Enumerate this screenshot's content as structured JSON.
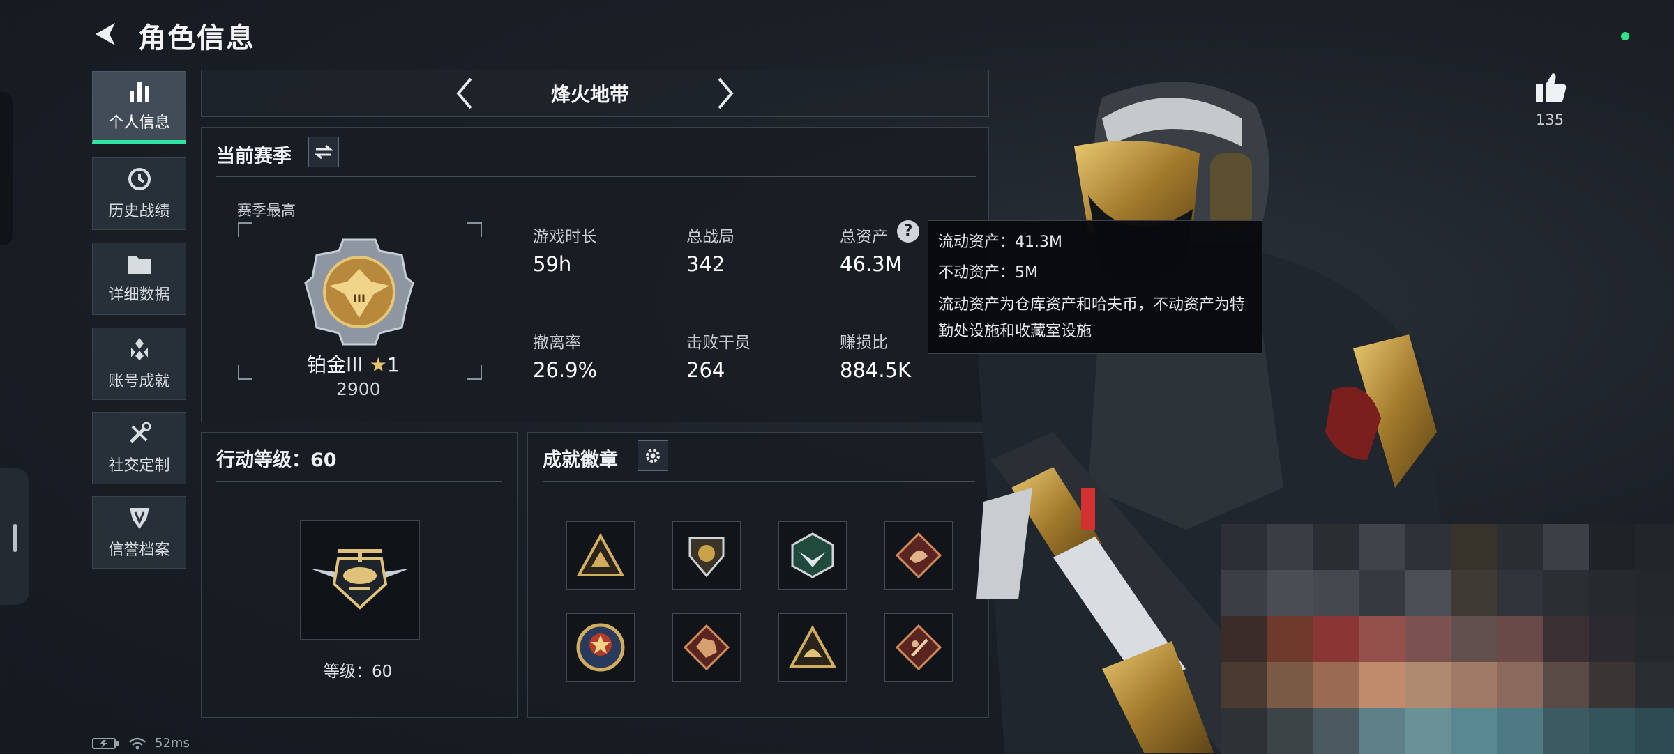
{
  "header": {
    "title": "角色信息"
  },
  "sidebar": {
    "items": [
      {
        "label": "个人信息",
        "icon": "bar-chart-icon",
        "active": true
      },
      {
        "label": "历史战绩",
        "icon": "clock-history-icon",
        "active": false
      },
      {
        "label": "详细数据",
        "icon": "folder-icon",
        "active": false
      },
      {
        "label": "账号成就",
        "icon": "achievement-icon",
        "active": false
      },
      {
        "label": "社交定制",
        "icon": "tools-icon",
        "active": false
      },
      {
        "label": "信誉档案",
        "icon": "shield-badge-icon",
        "active": false
      }
    ]
  },
  "mode_selector": {
    "label": "烽火地带"
  },
  "season": {
    "title": "当前赛季",
    "best_label": "赛季最高",
    "rank_name": "铂金III",
    "rank_stars": "1",
    "rank_score": "2900",
    "stats": [
      {
        "label": "游戏时长",
        "value": "59h"
      },
      {
        "label": "总战局",
        "value": "342"
      },
      {
        "label": "总资产",
        "value": "46.3M"
      },
      {
        "label": "撤离率",
        "value": "26.9%"
      },
      {
        "label": "击败干员",
        "value": "264"
      },
      {
        "label": "赚损比",
        "value": "884.5K"
      }
    ]
  },
  "tooltip": {
    "liquid": "流动资产：41.3M",
    "fixed": "不动资产：5M",
    "desc": "流动资产为仓库资产和哈夫币，不动资产为特勤处设施和收藏室设施"
  },
  "action_level": {
    "title": "行动等级：60",
    "level_text": "等级：60"
  },
  "badges": {
    "title": "成就徽章",
    "items": [
      {
        "icon": "triangle-crest-icon"
      },
      {
        "icon": "shield-crest-icon"
      },
      {
        "icon": "hexagon-bird-icon"
      },
      {
        "icon": "diamond-dragon-icon"
      },
      {
        "icon": "round-star-emblem-icon"
      },
      {
        "icon": "diamond-beast-icon"
      },
      {
        "icon": "triangle-helmet-icon"
      },
      {
        "icon": "diamond-blade-icon"
      }
    ]
  },
  "likes": {
    "count": "135"
  },
  "status_bar": {
    "ping": "52ms"
  },
  "colors": {
    "accent": "#2fe6a0",
    "gold": "#c9a24a",
    "online": "#2ee38a"
  }
}
